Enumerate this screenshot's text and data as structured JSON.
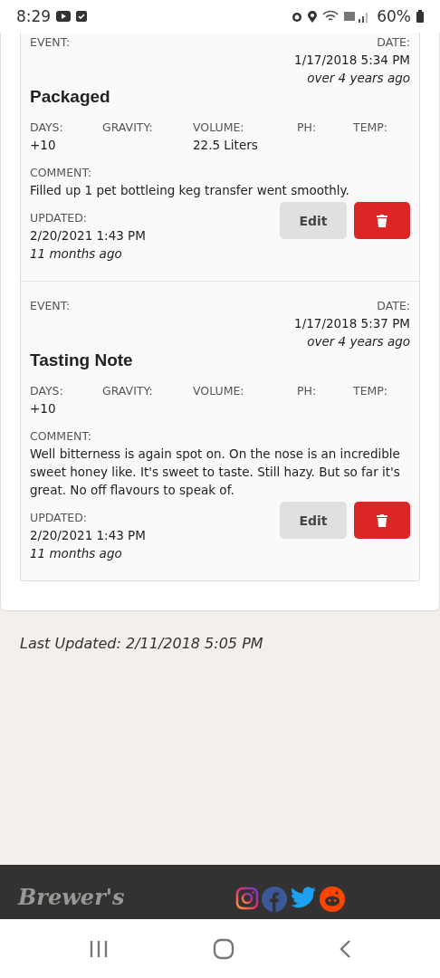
{
  "status_bar": {
    "time": "8:29",
    "battery": "60%"
  },
  "entries": [
    {
      "event_label": "EVENT:",
      "date_label": "DATE:",
      "date": "1/17/2018 5:34 PM",
      "date_ago": "over 4 years ago",
      "title": "Packaged",
      "fields": [
        {
          "label": "DAYS:",
          "value": "+10"
        },
        {
          "label": "GRAVITY:"
        },
        {
          "label": "VOLUME:",
          "value": "22.5 Liters"
        },
        {
          "label": "PH:"
        },
        {
          "label": "TEMP:"
        }
      ],
      "comment_label": "COMMENT:",
      "comment": "Filled up 1 pet bottleing keg transfer went smoothly.",
      "updated_label": "UPDATED:",
      "updated": "2/20/2021 1:43 PM",
      "updated_ago": "11 months ago",
      "edit": "Edit"
    },
    {
      "event_label": "EVENT:",
      "date_label": "DATE:",
      "date": "1/17/2018 5:37 PM",
      "date_ago": "over 4 years ago",
      "title": "Tasting Note",
      "fields": [
        {
          "label": "DAYS:",
          "value": "+10"
        },
        {
          "label": "GRAVITY:"
        },
        {
          "label": "VOLUME:"
        },
        {
          "label": "PH:"
        },
        {
          "label": "TEMP:"
        }
      ],
      "comment_label": "COMMENT:",
      "comment": "Well bitterness is again spot on. On the nose is an incredible sweet honey like. It's sweet to taste. Still hazy. But so far it's great. No off flavours to speak of.",
      "updated_label": "UPDATED:",
      "updated": "2/20/2021 1:43 PM",
      "updated_ago": "11 months ago",
      "edit": "Edit"
    }
  ],
  "last_updated": "Last Updated: 2/11/2018 5:05 PM",
  "footer": {
    "logo": "Brewer's"
  }
}
